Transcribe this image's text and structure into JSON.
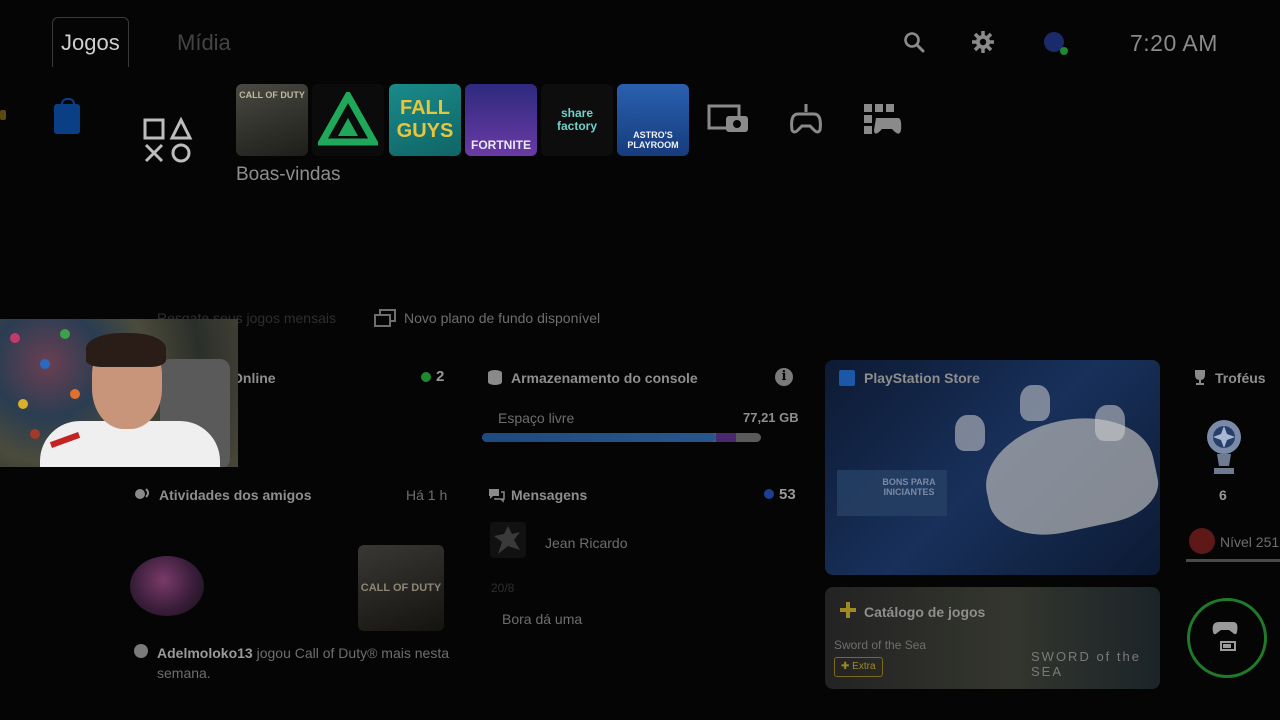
{
  "nav": {
    "tabs": [
      {
        "label": "Jogos",
        "active": true
      },
      {
        "label": "Mídia",
        "active": false
      }
    ],
    "icons": [
      "search-icon",
      "gear-icon",
      "user-avatar-icon"
    ],
    "clock": "7:20 AM"
  },
  "game_row": {
    "tiles": [
      {
        "name": "ps-store",
        "label": ""
      },
      {
        "name": "game-library",
        "label": ""
      },
      {
        "name": "call-of-duty",
        "label": "CALL OF DUTY"
      },
      {
        "name": "apex",
        "label": ""
      },
      {
        "name": "fall-guys",
        "label": "FALL GUYS"
      },
      {
        "name": "fortnite",
        "label": "FORTNITE"
      },
      {
        "name": "share-factory",
        "label": "share factory"
      },
      {
        "name": "astros-playroom",
        "label": "ASTRO'S PLAYROOM"
      },
      {
        "name": "media-gallery",
        "label": ""
      },
      {
        "name": "remote-play",
        "label": ""
      },
      {
        "name": "game-base",
        "label": ""
      }
    ],
    "selected_label": "Boas-vindas"
  },
  "notices": {
    "monthly": "Resgate seus jogos mensais",
    "wallpaper": "Novo plano de fundo disponível"
  },
  "online": {
    "title": "Online",
    "count": "2",
    "status_color": "#1d8a2e"
  },
  "storage": {
    "title": "Armazenamento do console",
    "free_label": "Espaço livre",
    "free_value": "77,21 GB",
    "used_fraction": 0.84,
    "purple_fraction": 0.07
  },
  "friends": {
    "title": "Atividades dos amigos",
    "time": "Há 1 h",
    "card_label": "CALL OF DUTY",
    "activity_user": "Adelmoloko13",
    "activity_text": "jogou Call of Duty® mais nesta semana."
  },
  "messages": {
    "title": "Mensagens",
    "count": "53",
    "sender": "Jean Ricardo",
    "date": "20/8",
    "text": "Bora dá uma"
  },
  "store_card": {
    "title": "PlayStation Store",
    "promo": "BONS PARA INICIANTES"
  },
  "catalog": {
    "title": "Catálogo de jogos",
    "game": "Sword of the Sea",
    "badge": "Extra",
    "logo": "SWORD of the SEA"
  },
  "trophies": {
    "title": "Troféus",
    "count": "6",
    "level": "Nível 251"
  },
  "colors": {
    "accent_blue": "#1c3f94",
    "online_green": "#1d8a2e",
    "extra_gold": "#a08a22"
  }
}
